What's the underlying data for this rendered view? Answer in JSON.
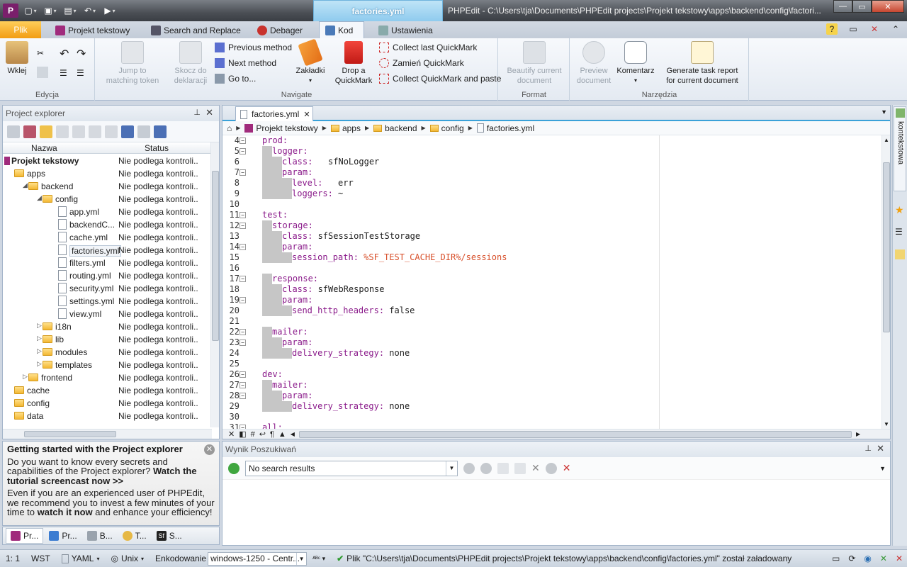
{
  "titlebar": {
    "context_tab": "factories.yml",
    "window_title": "PHPEdit - C:\\Users\\tja\\Documents\\PHPEdit projects\\Projekt tekstowy\\apps\\backend\\config\\factori..."
  },
  "tabs": {
    "file": "Plik",
    "items": [
      "Projekt tekstowy",
      "Search and Replace",
      "Debager",
      "Kod",
      "Ustawienia"
    ]
  },
  "ribbon": {
    "edycja": {
      "label": "Edycja",
      "paste": "Wklej"
    },
    "navigate": {
      "label": "Navigate",
      "jump": "Jump to\nmatching token",
      "skocz": "Skocz do\ndeklaracji",
      "prev_method": "Previous method",
      "next_method": "Next method",
      "goto": "Go to...",
      "zakladki": "Zakładki",
      "drop": "Drop a\nQuickMark",
      "collect_last": "Collect last QuickMark",
      "zamien": "Zamień QuickMark",
      "collect_paste": "Collect QuickMark and paste"
    },
    "format": {
      "label": "Format",
      "beautify": "Beautify current\ndocument"
    },
    "narzedzia": {
      "label": "Narzędzia",
      "preview": "Preview\ndocument",
      "komentarz": "Komentarz",
      "report": "Generate task report\nfor current document"
    }
  },
  "project_explorer": {
    "title": "Project explorer",
    "col_name": "Nazwa",
    "col_status": "Status",
    "status_text": "Nie podlega kontroli...",
    "rows": [
      {
        "name": "Projekt tekstowy",
        "level": 0,
        "type": "root",
        "exp": ""
      },
      {
        "name": "apps",
        "level": 1,
        "type": "folder",
        "exp": ""
      },
      {
        "name": "backend",
        "level": 2,
        "type": "folder",
        "exp": "◢"
      },
      {
        "name": "config",
        "level": 3,
        "type": "folder",
        "exp": "◢"
      },
      {
        "name": "app.yml",
        "level": 4,
        "type": "file",
        "exp": ""
      },
      {
        "name": "backendC...",
        "level": 4,
        "type": "file",
        "exp": ""
      },
      {
        "name": "cache.yml",
        "level": 4,
        "type": "file",
        "exp": ""
      },
      {
        "name": "factories.yml",
        "level": 4,
        "type": "file",
        "exp": "",
        "selected": true
      },
      {
        "name": "filters.yml",
        "level": 4,
        "type": "file",
        "exp": ""
      },
      {
        "name": "routing.yml",
        "level": 4,
        "type": "file",
        "exp": ""
      },
      {
        "name": "security.yml",
        "level": 4,
        "type": "file",
        "exp": ""
      },
      {
        "name": "settings.yml",
        "level": 4,
        "type": "file",
        "exp": ""
      },
      {
        "name": "view.yml",
        "level": 4,
        "type": "file",
        "exp": ""
      },
      {
        "name": "i18n",
        "level": 3,
        "type": "folder",
        "exp": "▷"
      },
      {
        "name": "lib",
        "level": 3,
        "type": "folder",
        "exp": "▷"
      },
      {
        "name": "modules",
        "level": 3,
        "type": "folder",
        "exp": "▷"
      },
      {
        "name": "templates",
        "level": 3,
        "type": "folder",
        "exp": "▷"
      },
      {
        "name": "frontend",
        "level": 2,
        "type": "folder",
        "exp": "▷"
      },
      {
        "name": "cache",
        "level": 1,
        "type": "folder",
        "exp": ""
      },
      {
        "name": "config",
        "level": 1,
        "type": "folder",
        "exp": ""
      },
      {
        "name": "data",
        "level": 1,
        "type": "folder",
        "exp": ""
      }
    ]
  },
  "getting_started": {
    "title": "Getting started with the Project explorer",
    "p1a": "Do you want to know every secrets and capabilities of the Project explorer? ",
    "p1b": "Watch the tutorial screencast now >>",
    "p2a": "Even if you are an experienced user of PHPEdit, we recommend you to invest a few minutes of your time to ",
    "p2b": "watch it now",
    "p2c": " and enhance your efficiency!"
  },
  "bottom_tabs": [
    "Pr...",
    "Pr...",
    "B...",
    "T...",
    "S..."
  ],
  "editor": {
    "tab": "factories.yml",
    "breadcrumb": [
      "Projekt tekstowy",
      "apps",
      "backend",
      "config",
      "factories.yml"
    ],
    "lines": [
      {
        "n": "4",
        "fold": "−",
        "ind": 0,
        "k": "prod",
        "rest": ""
      },
      {
        "n": "5",
        "fold": "−",
        "ind": 1,
        "k": "logger",
        "rest": ""
      },
      {
        "n": "6",
        "fold": "",
        "ind": 2,
        "k": "class",
        "rest": "   sfNoLogger"
      },
      {
        "n": "7",
        "fold": "−",
        "ind": 2,
        "k": "param",
        "rest": ""
      },
      {
        "n": "8",
        "fold": "",
        "ind": 3,
        "k": "level",
        "rest": "   err"
      },
      {
        "n": "9",
        "fold": "",
        "ind": 3,
        "k": "loggers",
        "rest": " ~"
      },
      {
        "n": "10",
        "fold": "",
        "ind": 0,
        "k": "",
        "rest": ""
      },
      {
        "n": "11",
        "fold": "−",
        "ind": 0,
        "k": "test",
        "rest": ""
      },
      {
        "n": "12",
        "fold": "−",
        "ind": 1,
        "k": "storage",
        "rest": ""
      },
      {
        "n": "13",
        "fold": "",
        "ind": 2,
        "k": "class",
        "rest": " sfSessionTestStorage"
      },
      {
        "n": "14",
        "fold": "−",
        "ind": 2,
        "k": "param",
        "rest": ""
      },
      {
        "n": "15",
        "fold": "",
        "ind": 3,
        "k": "session_path",
        "rest": " ",
        "s": "%SF_TEST_CACHE_DIR%/sessions"
      },
      {
        "n": "16",
        "fold": "",
        "ind": 0,
        "k": "",
        "rest": ""
      },
      {
        "n": "17",
        "fold": "−",
        "ind": 1,
        "k": "response",
        "rest": ""
      },
      {
        "n": "18",
        "fold": "",
        "ind": 2,
        "k": "class",
        "rest": " sfWebResponse"
      },
      {
        "n": "19",
        "fold": "−",
        "ind": 2,
        "k": "param",
        "rest": ""
      },
      {
        "n": "20",
        "fold": "",
        "ind": 3,
        "k": "send_http_headers",
        "rest": " false"
      },
      {
        "n": "21",
        "fold": "",
        "ind": 0,
        "k": "",
        "rest": ""
      },
      {
        "n": "22",
        "fold": "−",
        "ind": 1,
        "k": "mailer",
        "rest": ""
      },
      {
        "n": "23",
        "fold": "−",
        "ind": 2,
        "k": "param",
        "rest": ""
      },
      {
        "n": "24",
        "fold": "",
        "ind": 3,
        "k": "delivery_strategy",
        "rest": " none"
      },
      {
        "n": "25",
        "fold": "",
        "ind": 0,
        "k": "",
        "rest": ""
      },
      {
        "n": "26",
        "fold": "−",
        "ind": 0,
        "k": "dev",
        "rest": ""
      },
      {
        "n": "27",
        "fold": "−",
        "ind": 1,
        "k": "mailer",
        "rest": ""
      },
      {
        "n": "28",
        "fold": "−",
        "ind": 2,
        "k": "param",
        "rest": ""
      },
      {
        "n": "29",
        "fold": "",
        "ind": 3,
        "k": "delivery_strategy",
        "rest": " none"
      },
      {
        "n": "30",
        "fold": "",
        "ind": 0,
        "k": "",
        "rest": ""
      },
      {
        "n": "31",
        "fold": "−",
        "ind": 0,
        "k": "all",
        "rest": ""
      }
    ]
  },
  "search": {
    "title": "Wynik Poszukiwań",
    "result": "No search results"
  },
  "right_sidebar": {
    "label": "Pomoc kontekstowa"
  },
  "status": {
    "pos": "1:  1",
    "mode": "WST",
    "lang": "YAML",
    "eol": "Unix",
    "enc_label": "Enkodowanie",
    "encoding": "windows-1250 - Centr...",
    "message": "Plik \"C:\\Users\\tja\\Documents\\PHPEdit projects\\Projekt tekstowy\\apps\\backend\\config\\factories.yml\" został załadowany"
  },
  "colors": {
    "accent": "#3aa1d8",
    "file_tab": "#f29d13",
    "keyword": "#8a1a8a",
    "string": "#d8502b"
  }
}
